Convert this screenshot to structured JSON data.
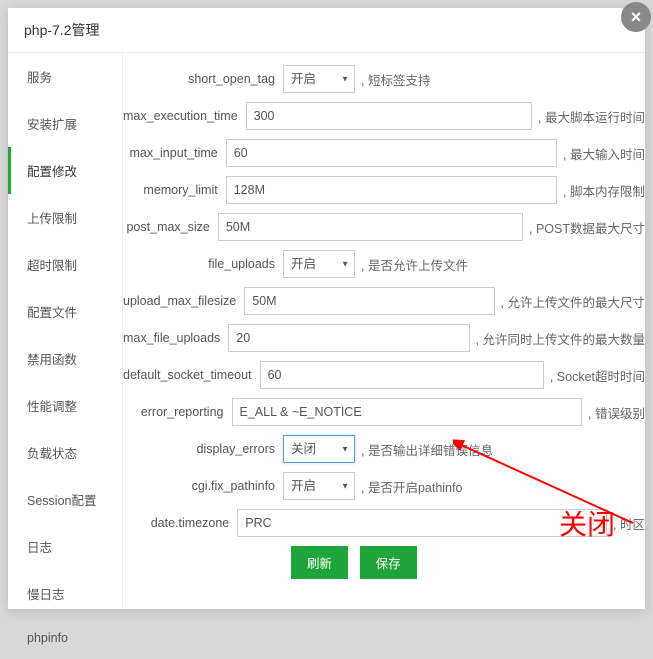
{
  "header": {
    "title": "php-7.2管理"
  },
  "sidebar": {
    "items": [
      {
        "label": "服务"
      },
      {
        "label": "安装扩展"
      },
      {
        "label": "配置修改"
      },
      {
        "label": "上传限制"
      },
      {
        "label": "超时限制"
      },
      {
        "label": "配置文件"
      },
      {
        "label": "禁用函数"
      },
      {
        "label": "性能调整"
      },
      {
        "label": "负载状态"
      },
      {
        "label": "Session配置"
      },
      {
        "label": "日志"
      },
      {
        "label": "慢日志"
      },
      {
        "label": "phpinfo"
      }
    ]
  },
  "form": {
    "rows": [
      {
        "label": "short_open_tag",
        "type": "select",
        "value": "开启",
        "desc": ", 短标签支持"
      },
      {
        "label": "max_execution_time",
        "type": "input",
        "value": "300",
        "desc": ", 最大脚本运行时间"
      },
      {
        "label": "max_input_time",
        "type": "input",
        "value": "60",
        "desc": ", 最大输入时间"
      },
      {
        "label": "memory_limit",
        "type": "input",
        "value": "128M",
        "desc": ", 脚本内存限制"
      },
      {
        "label": "post_max_size",
        "type": "input",
        "value": "50M",
        "desc": ", POST数据最大尺寸"
      },
      {
        "label": "file_uploads",
        "type": "select",
        "value": "开启",
        "desc": ", 是否允许上传文件"
      },
      {
        "label": "upload_max_filesize",
        "type": "input",
        "value": "50M",
        "desc": ", 允许上传文件的最大尺寸"
      },
      {
        "label": "max_file_uploads",
        "type": "input",
        "value": "20",
        "desc": ", 允许同时上传文件的最大数量"
      },
      {
        "label": "default_socket_timeout",
        "type": "input",
        "value": "60",
        "desc": ", Socket超时时间"
      },
      {
        "label": "error_reporting",
        "type": "input-wide",
        "value": "E_ALL & ~E_NOTICE",
        "desc": ", 错误级别"
      },
      {
        "label": "display_errors",
        "type": "select-focused",
        "value": "关闭",
        "desc": ", 是否输出详细错误信息"
      },
      {
        "label": "cgi.fix_pathinfo",
        "type": "select",
        "value": "开启",
        "desc": ", 是否开启pathinfo"
      },
      {
        "label": "date.timezone",
        "type": "input",
        "value": "PRC",
        "desc": ", 时区"
      }
    ],
    "refresh": "刷新",
    "save": "保存"
  },
  "annotation": {
    "text": "关闭"
  }
}
